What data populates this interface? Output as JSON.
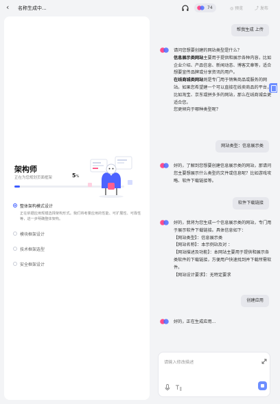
{
  "header": {
    "back_icon": "chevron-left-icon",
    "title": "名称生成中...",
    "credits": "74",
    "preview_label": "预览",
    "publish_label": "发布"
  },
  "left_panel": {
    "role_title": "架构师",
    "role_subtitle": "正在为您规划页面框架",
    "progress_percent": 5,
    "progress_text": "5",
    "progress_unit": "%",
    "steps": [
      {
        "name": "整体架构模式设计",
        "desc": "正在依据应用规模选择架构形式。我们将考量应用的性能、可扩展性、可靠性等，进一步明确整体架构。",
        "active": true
      },
      {
        "name": "模块框架设计",
        "desc": "",
        "active": false
      },
      {
        "name": "技术框架选型",
        "desc": "",
        "active": false
      },
      {
        "name": "安全框架设计",
        "desc": "",
        "active": false
      }
    ]
  },
  "chat": {
    "user_msg_1": "帮我生成  上传",
    "bot_msg_1": {
      "intro": "请问您想要创建的网站类型是什么？",
      "bold_a": "信息展示类网站",
      "text_a": "主要用于提供和展示各种内容，比如企业介绍、产品信息、新闻动态、博客文章等，适合想要宣传品牌或分享资讯的用户。",
      "bold_b": "在线商城类网站",
      "text_b": "则是专门用于销售商品或服务的网站。如果您希望建一个可以直接在线卖商品的平台，比如淘宝、京东或拼多多的网站，那么在线商城会更适合您。",
      "question": "您更倾向于哪种类型呢？"
    },
    "user_msg_2": "网站类型：信息展示类",
    "bot_msg_2": "好的，了解到您想要创建信息展示类的网站，那请问您主要想展示什么类型的文件或信息呢？比如游戏攻略、软件下载链接等。",
    "user_msg_3": "软件下载链接",
    "bot_msg_3": {
      "intro": "好的，我将为您生成一个信息展示类的网站，专门用于展示软件下载链接。具体信息如下：",
      "line1": "【网站类型】：信息展示类",
      "line2": "【网站名称】：本示例站及对 ：",
      "line3": "【网站描述及功能】：本网站主要用于提供和展示各类软件的下载链接，方便用户快速找到并下载所需软件。",
      "line4": "【网站设计要求】：无特定要求"
    },
    "user_msg_4": "创建应用",
    "bot_msg_4": "好的，正在生成应用..."
  },
  "input": {
    "placeholder": "请输入修改描述"
  },
  "colors": {
    "accent": "#3b5bff",
    "send_button": "#6d8eff",
    "user_bubble": "#e6e7ec"
  }
}
